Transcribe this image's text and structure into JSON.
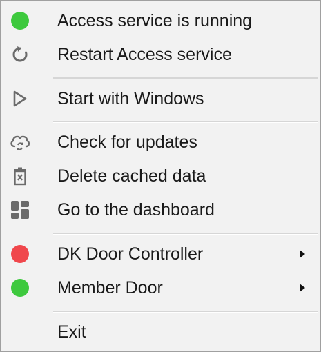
{
  "menu": {
    "items": [
      {
        "label": "Access service is running",
        "icon": "status-dot-icon",
        "color": "#3ec93e"
      },
      {
        "label": "Restart Access service",
        "icon": "restart-icon"
      },
      {
        "label": "Start with Windows",
        "icon": "play-icon"
      },
      {
        "label": "Check for updates",
        "icon": "cloud-sync-icon"
      },
      {
        "label": "Delete cached data",
        "icon": "trash-icon"
      },
      {
        "label": "Go to the dashboard",
        "icon": "dashboard-icon"
      },
      {
        "label": "DK Door Controller",
        "icon": "status-dot-icon",
        "color": "#f0474c",
        "submenu": true
      },
      {
        "label": "Member Door",
        "icon": "status-dot-icon",
        "color": "#3ec93e",
        "submenu": true
      },
      {
        "label": "Exit"
      }
    ]
  },
  "colors": {
    "running": "#3ec93e",
    "stopped": "#f0474c",
    "icon_gray": "#6b6b6b"
  }
}
